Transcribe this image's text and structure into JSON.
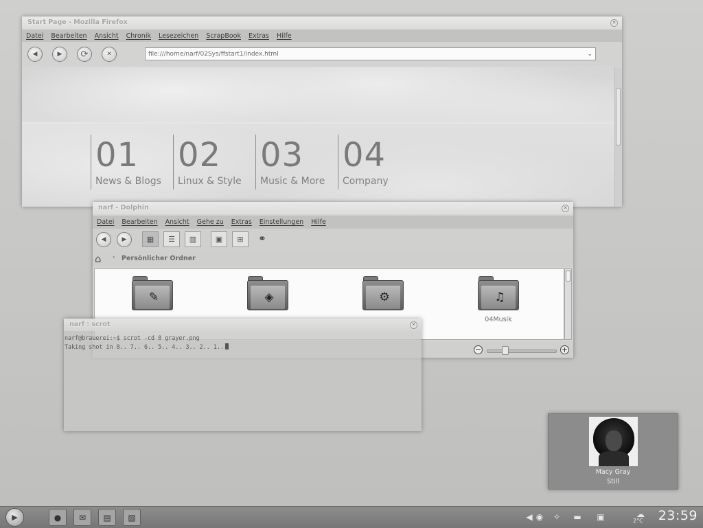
{
  "firefox": {
    "title": "Start Page - Mozilla Firefox",
    "menu": [
      "Datei",
      "Bearbeiten",
      "Ansicht",
      "Chronik",
      "Lesezeichen",
      "ScrapBook",
      "Extras",
      "Hilfe"
    ],
    "url": "file:///home/narf/02Sys/ffstart1/index.html",
    "tiles": [
      {
        "num": "01",
        "label": "News & Blogs"
      },
      {
        "num": "02",
        "label": "Linux & Style"
      },
      {
        "num": "03",
        "label": "Music & More"
      },
      {
        "num": "04",
        "label": "Company"
      }
    ]
  },
  "dolphin": {
    "title": "narf - Dolphin",
    "menu": [
      "Datei",
      "Bearbeiten",
      "Ansicht",
      "Gehe zu",
      "Extras",
      "Einstellungen",
      "Hilfe"
    ],
    "breadcrumb": "Persönlicher Ordner",
    "folders": [
      {
        "label": "",
        "icon": "document-icon"
      },
      {
        "label": "",
        "icon": "public-icon"
      },
      {
        "label": "",
        "icon": "settings-icon"
      },
      {
        "label": "04Musik",
        "icon": "music-icon"
      }
    ]
  },
  "terminal": {
    "title": "narf : scrot",
    "line1": "narf@brauerei:~$ scrot -cd 8 grayer.png",
    "line2": "Taking shot in 8.. 7.. 6.. 5.. 4.. 3.. 2.. 1.."
  },
  "now_playing": {
    "artist": "Macy Gray",
    "track": "Still"
  },
  "taskbar": {
    "clock": "23:59",
    "temperature": "2°C"
  }
}
